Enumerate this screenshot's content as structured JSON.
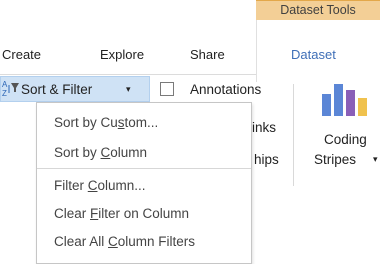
{
  "contextual_group": {
    "label": "Dataset Tools",
    "color": "#f3cf96"
  },
  "tabs": [
    {
      "label": "Create"
    },
    {
      "label": "Explore"
    },
    {
      "label": "Share"
    },
    {
      "label": "Dataset",
      "active": true
    }
  ],
  "toolbar": {
    "sort_filter": {
      "label": "Sort & Filter",
      "caret": "▾",
      "icon": "sort-az-filter-icon",
      "pressed": true
    },
    "annotations": {
      "label": "Annotations",
      "checked": false
    },
    "links_partial": "inks",
    "relationships_partial": "hips",
    "coding_stripes": {
      "line1": "Coding",
      "line2": "Stripes",
      "caret": "▾",
      "icon": "coding-stripes-icon"
    }
  },
  "menu": {
    "items_group1": [
      {
        "pre": "Sort by Cu",
        "u": "s",
        "post": "tom..."
      },
      {
        "pre": "Sort by ",
        "u": "C",
        "post": "olumn"
      }
    ],
    "items_group2": [
      {
        "pre": "Filter ",
        "u": "C",
        "post": "olumn..."
      },
      {
        "pre": "Clear ",
        "u": "F",
        "post": "ilter on Column"
      },
      {
        "pre": "Clear All ",
        "u": "C",
        "post": "olumn Filters"
      }
    ]
  },
  "colors": {
    "accent_tab": "#3f6fb7",
    "pressed_bg": "#cfe2f5",
    "stripe_blue": "#5b86d6",
    "stripe_purple": "#8a5fb8",
    "stripe_yellow": "#f0c24e"
  }
}
